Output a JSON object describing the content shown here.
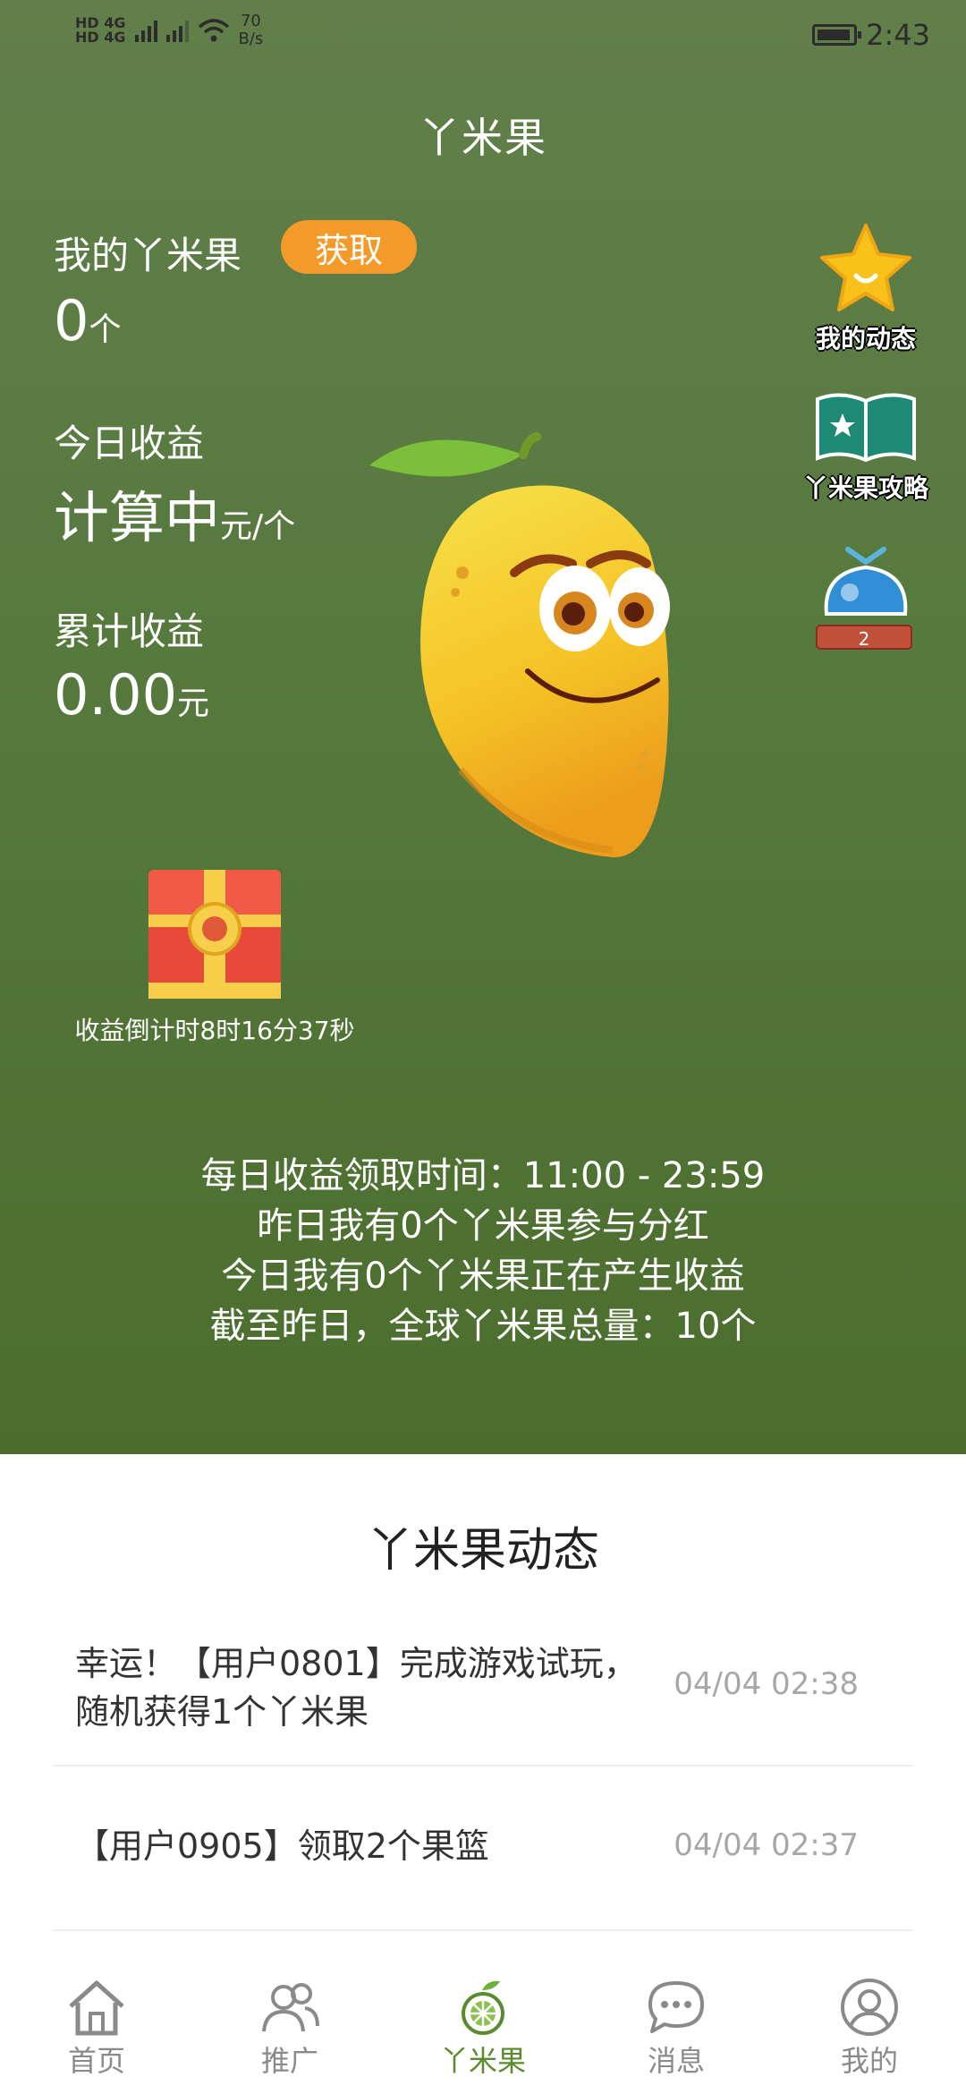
{
  "status_bar": {
    "sim1": "HD 4G",
    "sim2": "HD 4G",
    "net_speed_value": "70",
    "net_speed_unit": "B/s",
    "time": "2:43"
  },
  "page_title": "丫米果",
  "my_fruit": {
    "label": "我的丫米果",
    "get_button": "获取",
    "count": "0",
    "unit": "个"
  },
  "today_income": {
    "label": "今日收益",
    "value": "计算中",
    "unit": "元/个"
  },
  "total_income": {
    "label": "累计收益",
    "value": "0.00",
    "unit": "元"
  },
  "side_menu": [
    {
      "label": "我的动态",
      "icon": "star-smile-icon"
    },
    {
      "label": "丫米果攻略",
      "icon": "book-star-icon"
    },
    {
      "badge": "2",
      "icon": "fruit-basket-icon"
    }
  ],
  "chest": {
    "caption": "收益倒计时8时16分37秒",
    "icon": "treasure-chest-icon"
  },
  "info_lines": [
    "每日收益领取时间：11:00 - 23:59",
    "昨日我有0个丫米果参与分红",
    "今日我有0个丫米果正在产生收益",
    "截至昨日，全球丫米果总量：10个"
  ],
  "feed": {
    "title": "丫米果动态",
    "items": [
      {
        "text": "幸运！【用户0801】完成游戏试玩，随机获得1个丫米果",
        "time": "04/04 02:38"
      },
      {
        "text": "【用户0905】领取2个果篮",
        "time": "04/04 02:37"
      }
    ]
  },
  "nav": [
    {
      "label": "首页",
      "icon": "home-icon"
    },
    {
      "label": "推广",
      "icon": "users-icon"
    },
    {
      "label": "丫米果",
      "icon": "fruit-icon",
      "active": true
    },
    {
      "label": "消息",
      "icon": "chat-bubble-icon"
    },
    {
      "label": "我的",
      "icon": "person-icon"
    }
  ],
  "colors": {
    "hero_green": "#56793d",
    "accent_orange": "#f39a2a",
    "active_nav_green": "#5a8b2e"
  }
}
